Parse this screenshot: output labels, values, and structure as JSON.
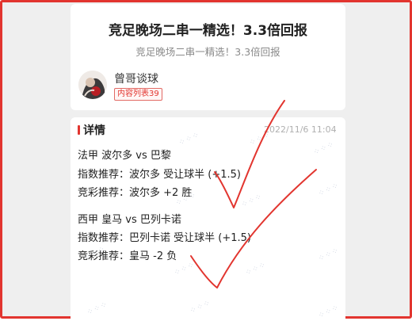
{
  "article": {
    "title": "竞足晚场二串一精选！3.3倍回报",
    "subtitle": "竞足晚场二串一精选！3.3倍回报"
  },
  "author": {
    "name": "曾哥谈球",
    "badge": "内容列表39"
  },
  "details": {
    "section_title": "详情",
    "date": "2022/11/6 11:04",
    "matches": [
      {
        "match_line": "法甲 波尔多 vs 巴黎",
        "handicap_pick": "指数推荐：波尔多 受让球半 (+1.5)",
        "lottery_pick": "竞彩推荐：波尔多 +2 胜"
      },
      {
        "match_line": "西甲 皇马 vs 巴列卡诺",
        "handicap_pick": "指数推荐：巴列卡诺 受让球半 (+1.5)",
        "lottery_pick": "竞彩推荐：皇马 -2 负"
      }
    ]
  },
  "colors": {
    "accent": "#e2352f",
    "frame": "#e2352f",
    "background": "#efefef",
    "card": "#ffffff"
  }
}
